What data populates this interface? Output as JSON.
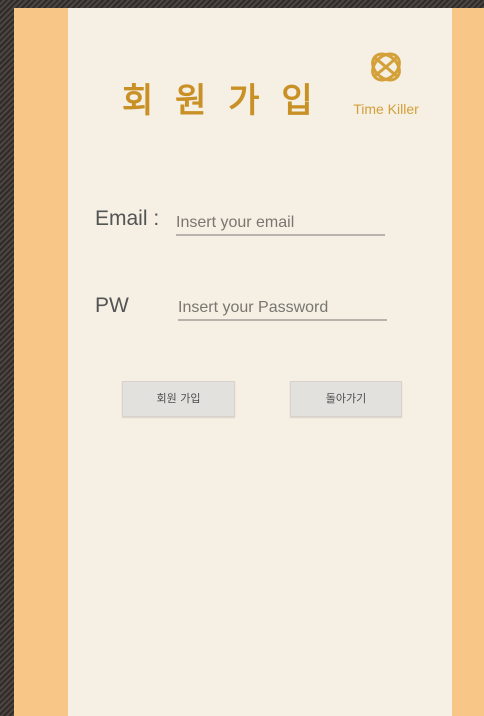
{
  "screen": {
    "title": "회 원 가 입",
    "brand_name": "Time Killer",
    "icons": {
      "logo": "interlocked-globe-icon"
    },
    "colors": {
      "outer_rail": "#f8c686",
      "panel_background": "#f5efe4",
      "accent_gold": "#c99125",
      "button_background": "#e3e1de"
    }
  },
  "form": {
    "email_label": "Email :",
    "email_placeholder": "Insert your email",
    "email_value": "",
    "password_label": "PW",
    "password_placeholder": "Insert your Password",
    "password_value": ""
  },
  "actions": {
    "signup_label": "회원 가입",
    "back_label": "돌아가기"
  }
}
